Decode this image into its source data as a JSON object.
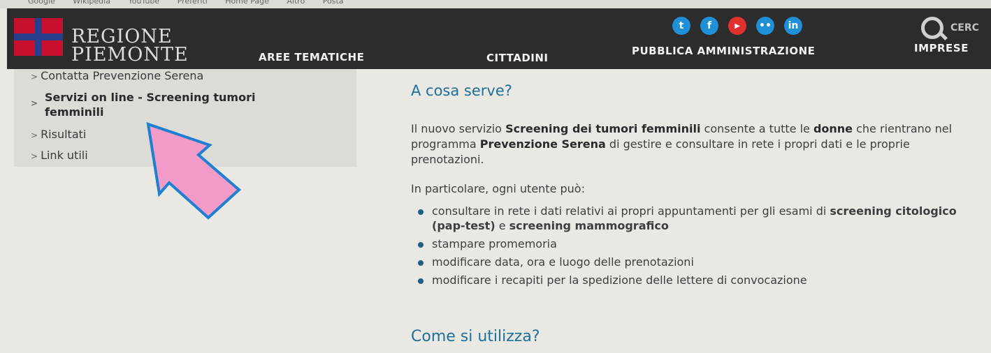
{
  "bookmarks": [
    "Google",
    "Wikipedia",
    "YouTube",
    "Preferiti",
    "Home Page",
    "Altro",
    "Posta"
  ],
  "header": {
    "logo_line1": "REGIONE",
    "logo_line2": "PIEMONTE",
    "nav": [
      "AREE TEMATICHE",
      "CITTADINI",
      "PUBBLICA AMMINISTRAZIONE",
      "IMPRESE"
    ],
    "social": [
      "twitter-icon",
      "facebook-icon",
      "youtube-icon",
      "flickr-icon",
      "linkedin-icon"
    ],
    "search_label": "CERC"
  },
  "sidebar": {
    "items": [
      {
        "label": "Contatta Prevenzione Serena"
      },
      {
        "label": "Servizi on line - Screening tumori femminili"
      },
      {
        "label": "Risultati"
      },
      {
        "label": "Link utili"
      }
    ]
  },
  "content": {
    "heading1": "A cosa serve?",
    "intro_part1": "Il nuovo servizio ",
    "intro_bold1": "Screening dei tumori femminili",
    "intro_part2": " consente a tutte le ",
    "intro_bold2": "donne",
    "intro_part3": " che rientrano nel programma ",
    "intro_bold3": "Prevenzione Serena",
    "intro_part4": " di gestire e consultare in rete i propri dati e le proprie prenotazioni.",
    "lead": "In particolare, ogni utente può:",
    "bullets": [
      {
        "text": "consultare in rete i dati relativi ai propri appuntamenti per gli esami di ",
        "b1": "screening citologico (pap-test)",
        "mid": " e ",
        "b2": "screening mammografico"
      },
      {
        "text": "stampare promemoria"
      },
      {
        "text": "modificare data, ora e luogo delle prenotazioni"
      },
      {
        "text": "modificare i recapiti per la spedizione delle lettere di convocazione"
      }
    ],
    "heading2": "Come si utilizza?"
  },
  "colors": {
    "header_bg": "#2c2c2c",
    "heading": "#1e6f9a",
    "arrow_fill": "#f29bc9",
    "arrow_stroke": "#1f7fd0"
  }
}
